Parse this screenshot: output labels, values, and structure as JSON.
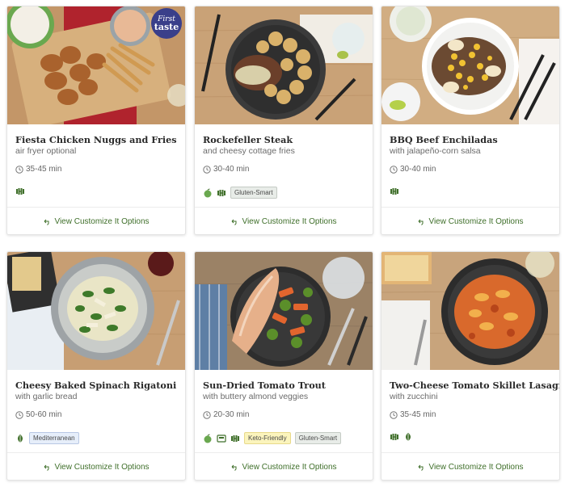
{
  "cards": [
    {
      "title": "Fiesta Chicken Nuggs and Fries",
      "subtitle": "air fryer optional",
      "time": "35-45 min",
      "badge": {
        "line1": "First",
        "line2": "taste"
      },
      "tag_icons": [
        "dumbbell-icon"
      ],
      "pills": [],
      "customize": "View Customize It Options"
    },
    {
      "title": "Rockefeller Steak",
      "subtitle": "and cheesy cottage fries",
      "time": "30-40 min",
      "tag_icons": [
        "apple-icon",
        "dumbbell-icon"
      ],
      "pills": [
        "Gluten-Smart"
      ],
      "customize": "View Customize It Options"
    },
    {
      "title": "BBQ Beef Enchiladas",
      "subtitle": "with jalapeño-corn salsa",
      "time": "30-40 min",
      "tag_icons": [
        "dumbbell-icon"
      ],
      "pills": [],
      "customize": "View Customize It Options"
    },
    {
      "title": "Cheesy Baked Spinach Rigatoni",
      "subtitle": "with garlic bread",
      "time": "50-60 min",
      "tag_icons": [
        "leaf-icon"
      ],
      "pills": [
        "Mediterranean"
      ],
      "customize": "View Customize It Options"
    },
    {
      "title": "Sun-Dried Tomato Trout",
      "subtitle": "with buttery almond veggies",
      "time": "20-30 min",
      "tag_icons": [
        "apple-icon",
        "scale-icon",
        "dumbbell-icon"
      ],
      "pills": [
        "Keto-Friendly",
        "Gluten-Smart"
      ],
      "customize": "View Customize It Options"
    },
    {
      "title": "Two-Cheese Tomato Skillet Lasagna",
      "subtitle": "with zucchini",
      "time": "35-45 min",
      "tag_icons": [
        "dumbbell-icon",
        "leaf-icon"
      ],
      "pills": [],
      "customize": "View Customize It Options"
    }
  ],
  "colors": {
    "accent_green": "#3f6f2a",
    "badge_navy": "#3a3f8a",
    "wood": "#c9a277"
  }
}
